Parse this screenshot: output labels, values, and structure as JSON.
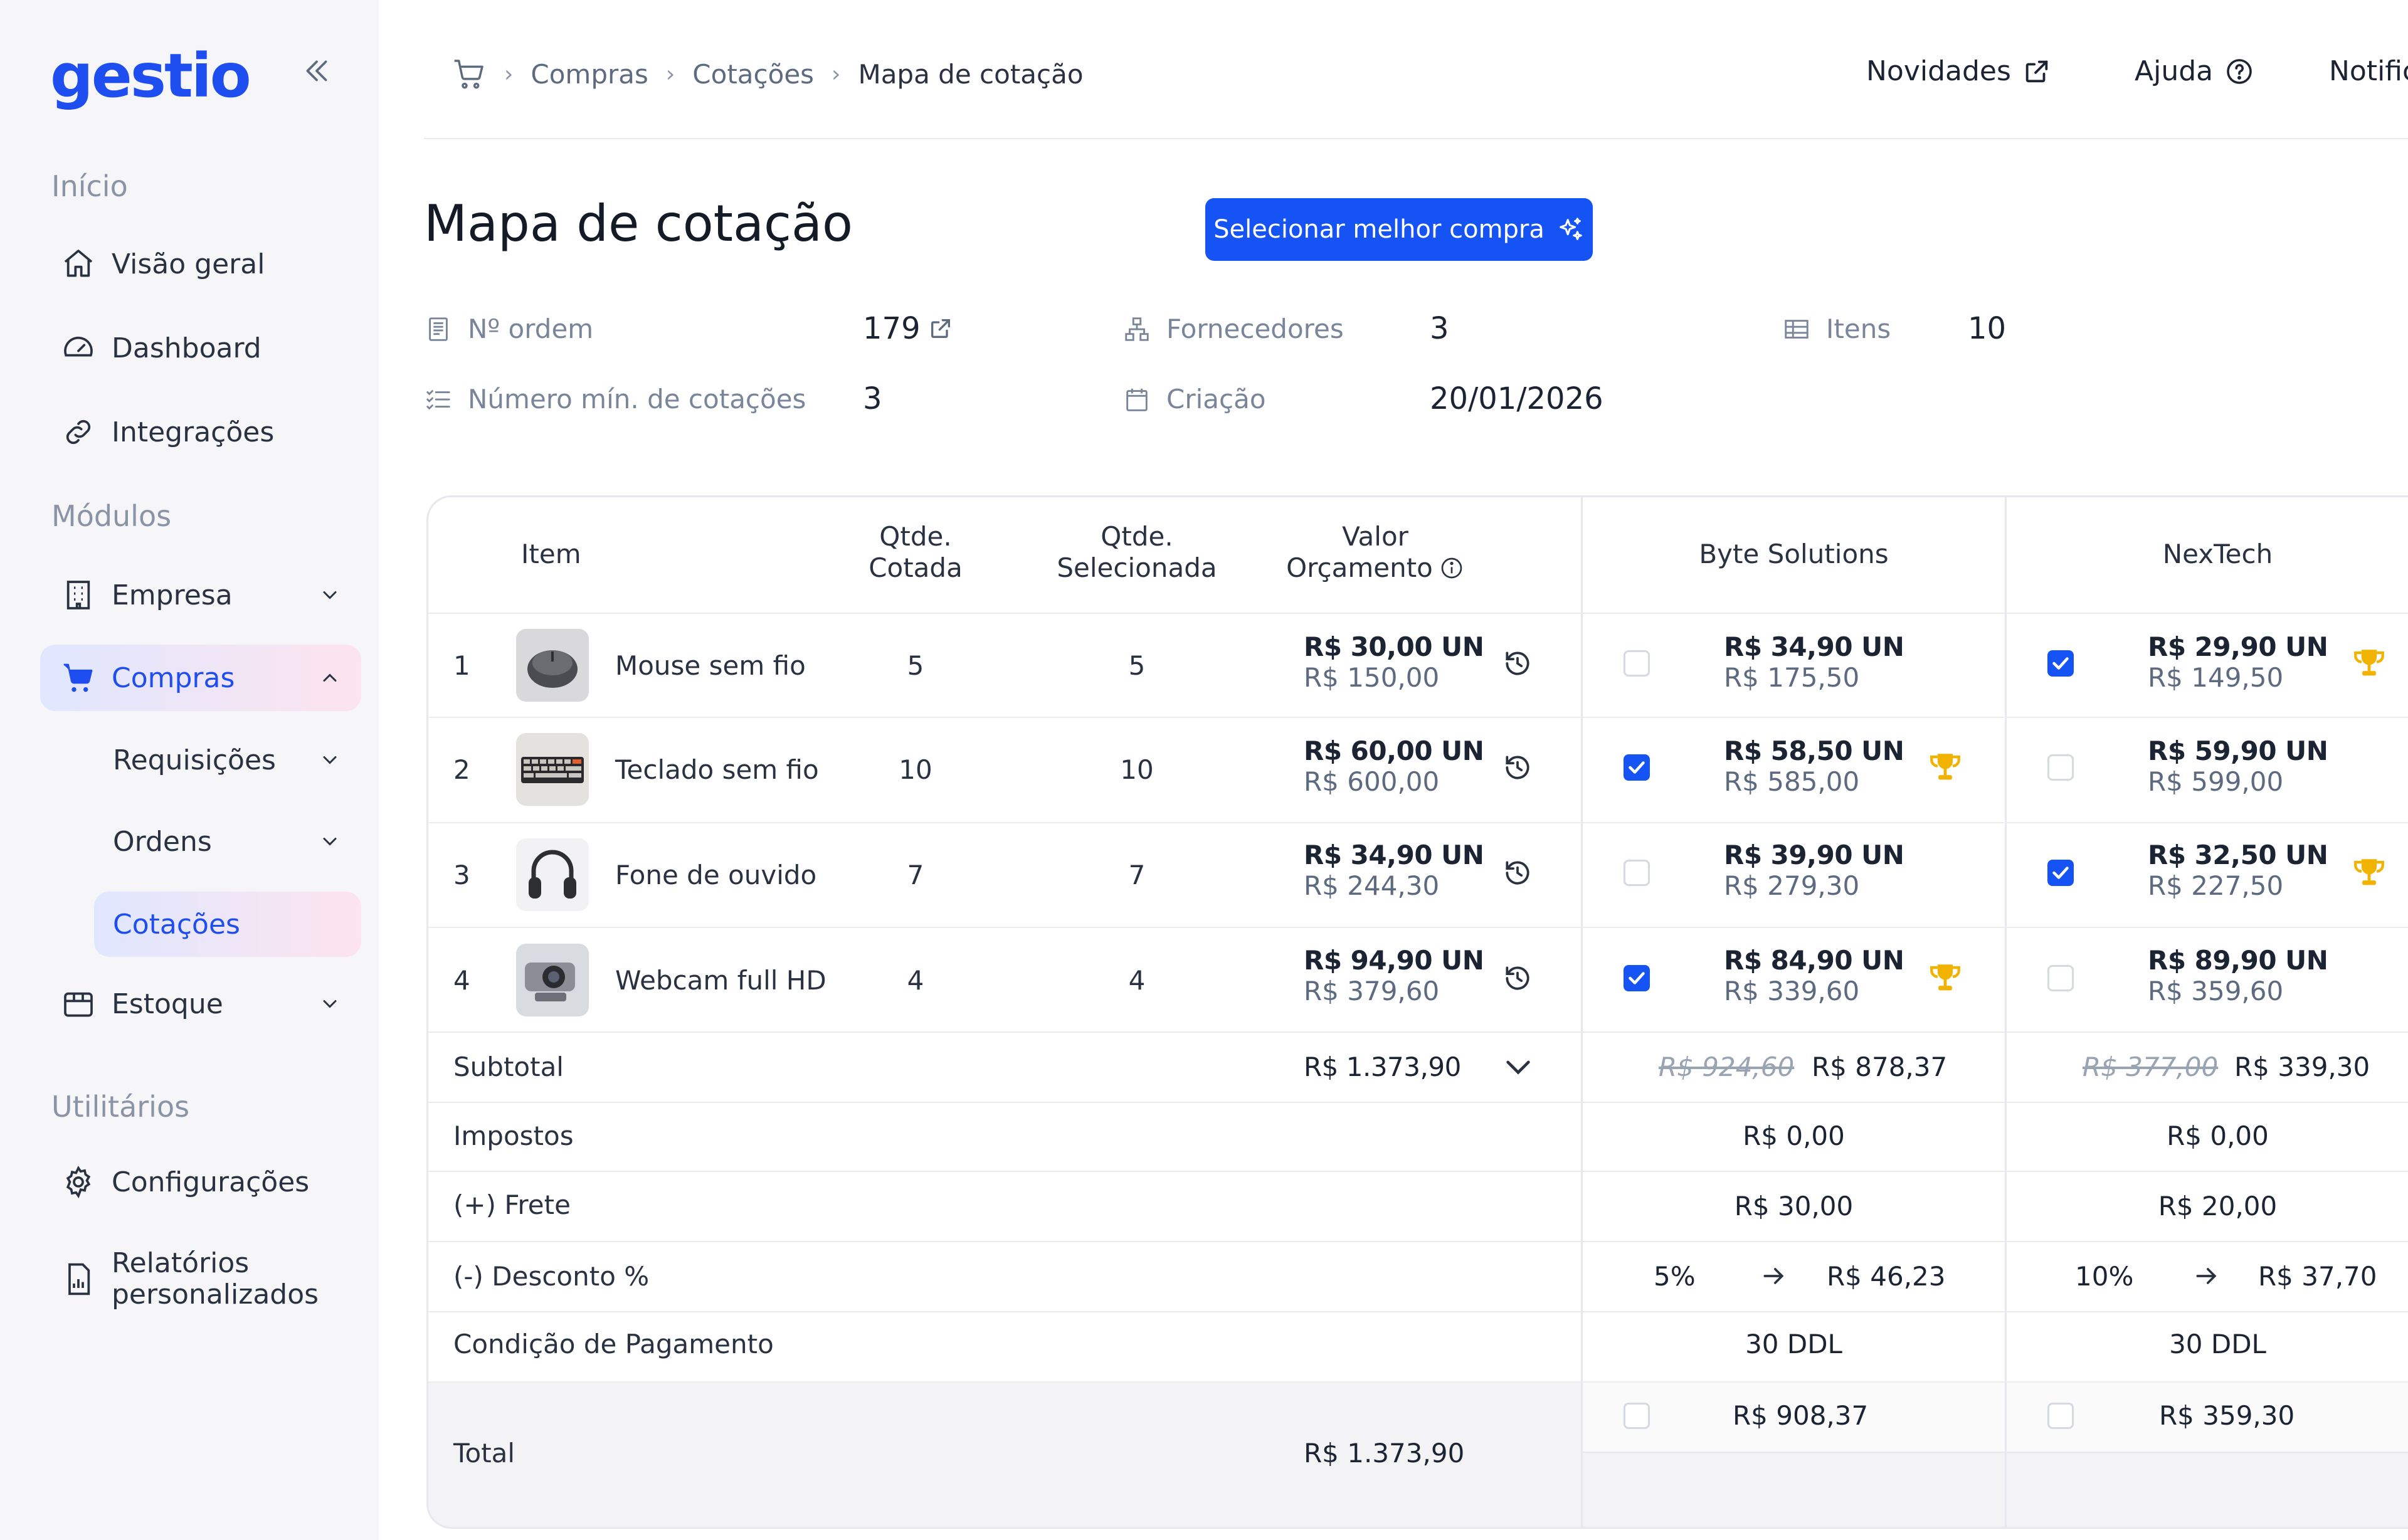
{
  "brand": {
    "logo_text": "gestio"
  },
  "sidebar": {
    "sections": {
      "inicio": "Início",
      "modulos": "Módulos",
      "utilitarios": "Utilitários"
    },
    "items": {
      "visao_geral": "Visão geral",
      "dashboard": "Dashboard",
      "integracoes": "Integrações",
      "empresa": "Empresa",
      "compras": "Compras",
      "requisicoes": "Requisições",
      "ordens": "Ordens",
      "cotacoes": "Cotações",
      "estoque": "Estoque",
      "configuracoes": "Configurações",
      "relatorios_1": "Relatórios",
      "relatorios_2": "personalizados"
    }
  },
  "breadcrumb": [
    "Compras",
    "Cotações",
    "Mapa de cotação"
  ],
  "topnav": {
    "novidades": "Novidades",
    "ajuda": "Ajuda",
    "notificacoes": "Notific"
  },
  "page": {
    "title": "Mapa de cotação",
    "best_button": "Selecionar melhor compra"
  },
  "meta": {
    "ordem_label": "Nº ordem",
    "ordem_value": "179",
    "fornecedores_label": "Fornecedores",
    "fornecedores_value": "3",
    "itens_label": "Itens",
    "itens_value": "10",
    "min_cot_label": "Número mín. de cotações",
    "min_cot_value": "3",
    "criacao_label": "Criação",
    "criacao_value": "20/01/2026"
  },
  "table": {
    "headers": {
      "item": "Item",
      "qtde_cotada_1": "Qtde.",
      "qtde_cotada_2": "Cotada",
      "qtde_sel_1": "Qtde.",
      "qtde_sel_2": "Selecionada",
      "valor_1": "Valor",
      "valor_2": "Orçamento"
    },
    "suppliers": [
      "Byte Solutions",
      "NexTech"
    ],
    "rows": [
      {
        "n": "1",
        "name": "Mouse sem fio",
        "cotada": "5",
        "selecionada": "5",
        "unit": "R$ 30,00 UN",
        "total": "R$ 150,00",
        "s1": {
          "unit": "R$ 34,90 UN",
          "total": "R$ 175,50",
          "checked": false,
          "best": false
        },
        "s2": {
          "unit": "R$ 29,90 UN",
          "total": "R$ 149,50",
          "checked": true,
          "best": true
        }
      },
      {
        "n": "2",
        "name": "Teclado sem fio",
        "cotada": "10",
        "selecionada": "10",
        "unit": "R$ 60,00 UN",
        "total": "R$ 600,00",
        "s1": {
          "unit": "R$ 58,50 UN",
          "total": "R$ 585,00",
          "checked": true,
          "best": true
        },
        "s2": {
          "unit": "R$ 59,90 UN",
          "total": "R$ 599,00",
          "checked": false,
          "best": false
        }
      },
      {
        "n": "3",
        "name": "Fone de ouvido",
        "cotada": "7",
        "selecionada": "7",
        "unit": "R$ 34,90 UN",
        "total": "R$ 244,30",
        "s1": {
          "unit": "R$ 39,90 UN",
          "total": "R$ 279,30",
          "checked": false,
          "best": false
        },
        "s2": {
          "unit": "R$ 32,50 UN",
          "total": "R$ 227,50",
          "checked": true,
          "best": true
        }
      },
      {
        "n": "4",
        "name": "Webcam full HD",
        "cotada": "4",
        "selecionada": "4",
        "unit": "R$ 94,90 UN",
        "total": "R$ 379,60",
        "s1": {
          "unit": "R$ 84,90 UN",
          "total": "R$ 339,60",
          "checked": true,
          "best": true
        },
        "s2": {
          "unit": "R$ 89,90 UN",
          "total": "R$ 359,60",
          "checked": false,
          "best": false
        }
      }
    ],
    "summary": {
      "subtotal_label": "Subtotal",
      "subtotal_value": "R$ 1.373,90",
      "s1_subtotal_old": "R$ 924,60",
      "s1_subtotal": "R$ 878,37",
      "s2_subtotal_old": "R$ 377,00",
      "s2_subtotal": "R$ 339,30",
      "impostos_label": "Impostos",
      "s1_impostos": "R$ 0,00",
      "s2_impostos": "R$ 0,00",
      "frete_label": "(+) Frete",
      "s1_frete": "R$ 30,00",
      "s2_frete": "R$ 20,00",
      "desconto_label": "(-) Desconto %",
      "s1_desc_pct": "5%",
      "s1_desc_val": "R$ 46,23",
      "s2_desc_pct": "10%",
      "s2_desc_val": "R$ 37,70",
      "cond_label": "Condição de Pagamento",
      "s1_cond": "30 DDL",
      "s2_cond": "30 DDL",
      "total_label": "Total",
      "total_value": "R$ 1.373,90",
      "s1_total": "R$ 908,37",
      "s2_total": "R$ 359,30"
    }
  },
  "colors": {
    "accent": "#1553f5",
    "trophy": "#f2b300",
    "sidebar_bg": "#f6f6f8"
  }
}
